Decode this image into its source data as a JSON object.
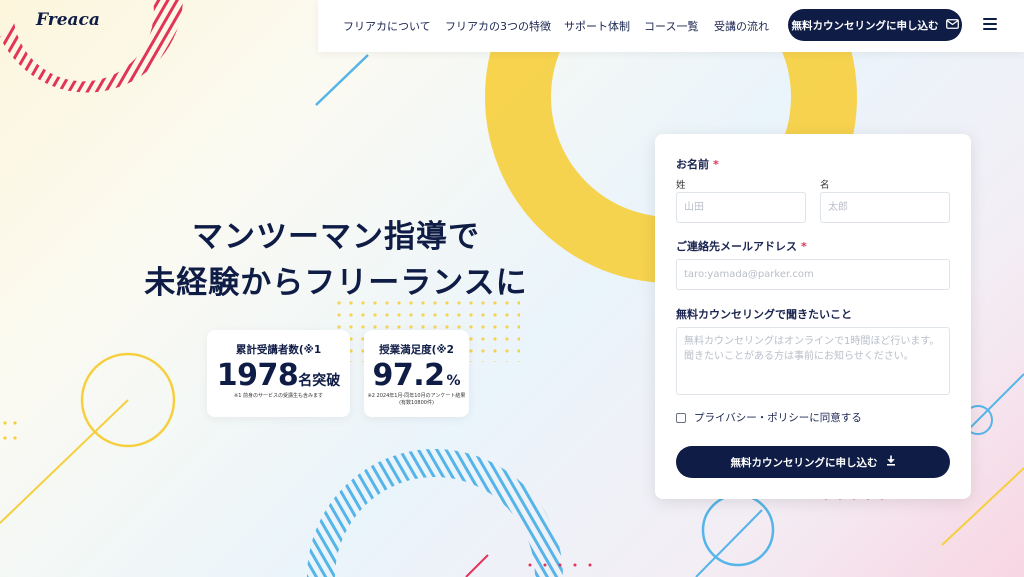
{
  "logo": "Freaca",
  "nav": {
    "links": [
      "フリアカについて",
      "フリアカの3つの特徴",
      "サポート体制",
      "コース一覧",
      "受講の流れ"
    ],
    "cta_label": "無料カウンセリングに申し込む",
    "cta_icon": "mail-icon",
    "menu_icon": "hamburger-icon"
  },
  "hero": {
    "line1": "マンツーマン指導で",
    "line2": "未経験からフリーランスに"
  },
  "stats": [
    {
      "title": "累計受講者数(※1",
      "value": "1978",
      "unit": "名突破",
      "note": "※1 前身のサービスの受講生も含みます"
    },
    {
      "title": "授業満足度(※2",
      "value": "97.2",
      "unit": "%",
      "note": "※2 2024年1月-同年10月のアンケート結果",
      "note2": "(有数10800件)"
    }
  ],
  "form": {
    "name_label": "お名前",
    "required_mark": "*",
    "last_name_label": "姓",
    "first_name_label": "名",
    "last_name_placeholder": "山田",
    "first_name_placeholder": "太郎",
    "email_label": "ご連絡先メールアドレス",
    "email_placeholder": "taro:yamada@parker.com",
    "question_label": "無料カウンセリングで聞きたいこと",
    "question_placeholder": "無料カウンセリングはオンラインで1時間ほど行います。聞きたいことがある方は事前にお知らせください。",
    "privacy_label": "プライバシー・ポリシーに同意する",
    "submit_label": "無料カウンセリングに申し込む",
    "submit_icon": "download-arrow-icon"
  },
  "colors": {
    "navy": "#0f1c45",
    "yellow": "#f6cf3f",
    "pink": "#e0345a",
    "blue": "#55b4e8",
    "required": "#e0345a"
  }
}
